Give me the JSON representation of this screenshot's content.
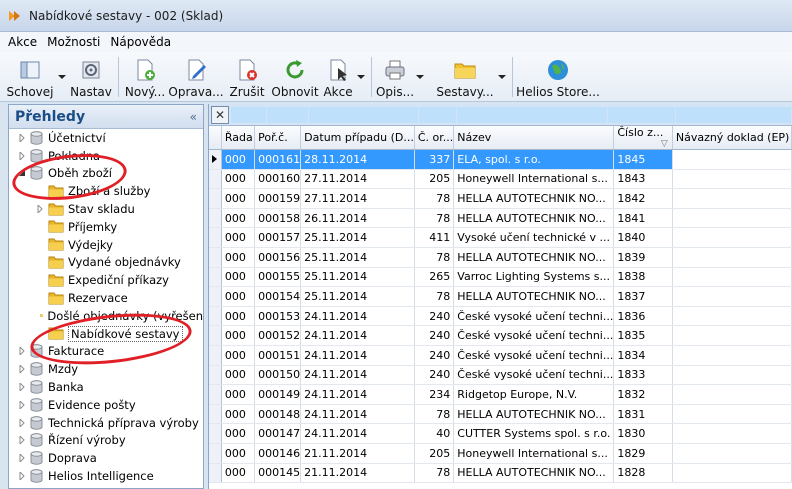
{
  "window": {
    "title": "Nabídkové sestavy - 002 (Sklad)"
  },
  "menu": [
    "Akce",
    "Možnosti",
    "Nápověda"
  ],
  "toolbar": [
    {
      "label": "Schovej",
      "icon": "schovej-icon",
      "dropdown": true
    },
    {
      "label": "Nastav",
      "icon": "gear-icon",
      "dropdown": false
    },
    {
      "label": "Nový...",
      "icon": "new-document-icon",
      "dropdown": false
    },
    {
      "label": "Oprava...",
      "icon": "edit-document-icon",
      "dropdown": false
    },
    {
      "label": "Zrušit",
      "icon": "delete-document-icon",
      "dropdown": false
    },
    {
      "label": "Obnovit",
      "icon": "refresh-icon",
      "dropdown": false
    },
    {
      "label": "Akce",
      "icon": "action-icon",
      "dropdown": true
    },
    {
      "label": "Opis...",
      "icon": "printer-icon",
      "dropdown": true
    },
    {
      "label": "Sestavy...",
      "icon": "folder-icon",
      "dropdown": true
    },
    {
      "label": "Helios Store...",
      "icon": "globe-icon",
      "dropdown": false
    }
  ],
  "sidebar": {
    "title": "Přehledy",
    "collapse_glyph": "«",
    "items": [
      {
        "label": "Účetnictví",
        "level": 0,
        "icon": "database-icon",
        "expanded": false
      },
      {
        "label": "Pokladna",
        "level": 0,
        "icon": "database-icon",
        "expanded": false
      },
      {
        "label": "Oběh zboží",
        "level": 0,
        "icon": "database-icon",
        "expanded": true
      },
      {
        "label": "Zboží a služby",
        "level": 1,
        "icon": "folder-icon",
        "expanded": null
      },
      {
        "label": "Stav skladu",
        "level": 1,
        "icon": "folder-icon",
        "expanded": false
      },
      {
        "label": "Příjemky",
        "level": 1,
        "icon": "folder-icon",
        "expanded": null
      },
      {
        "label": "Výdejky",
        "level": 1,
        "icon": "folder-icon",
        "expanded": null
      },
      {
        "label": "Vydané objednávky",
        "level": 1,
        "icon": "folder-icon",
        "expanded": null
      },
      {
        "label": "Expediční příkazy",
        "level": 1,
        "icon": "folder-icon",
        "expanded": null
      },
      {
        "label": "Rezervace",
        "level": 1,
        "icon": "folder-icon",
        "expanded": null
      },
      {
        "label": "Došlé objednávky (vyřešen",
        "level": 1,
        "icon": "folder-icon",
        "expanded": null
      },
      {
        "label": "Nabídkové sestavy",
        "level": 1,
        "icon": "folder-icon",
        "expanded": null,
        "selected": true
      },
      {
        "label": "Fakturace",
        "level": 0,
        "icon": "database-icon",
        "expanded": false
      },
      {
        "label": "Mzdy",
        "level": 0,
        "icon": "database-icon",
        "expanded": false
      },
      {
        "label": "Banka",
        "level": 0,
        "icon": "database-icon",
        "expanded": false
      },
      {
        "label": "Evidence pošty",
        "level": 0,
        "icon": "database-icon",
        "expanded": false
      },
      {
        "label": "Technická příprava výroby",
        "level": 0,
        "icon": "database-icon",
        "expanded": false
      },
      {
        "label": "Řízení výroby",
        "level": 0,
        "icon": "database-icon",
        "expanded": false
      },
      {
        "label": "Doprava",
        "level": 0,
        "icon": "database-icon",
        "expanded": false
      },
      {
        "label": "Helios Intelligence",
        "level": 0,
        "icon": "database-icon",
        "expanded": false
      }
    ]
  },
  "grid": {
    "columns": [
      "Řada",
      "Poř.č.",
      "Datum případu (D...",
      "Č. or...",
      "Název",
      "Číslo z...",
      "Návazný doklad (EP)"
    ],
    "sort_glyph": "▽",
    "selected_row": 0,
    "rows": [
      [
        "000",
        "000161",
        "28.11.2014",
        "337",
        "ELA, spol. s r.o.",
        "1845",
        ""
      ],
      [
        "000",
        "000160",
        "27.11.2014",
        "205",
        "Honeywell International s...",
        "1843",
        ""
      ],
      [
        "000",
        "000159",
        "27.11.2014",
        "78",
        "HELLA AUTOTECHNIK NO...",
        "1842",
        ""
      ],
      [
        "000",
        "000158",
        "26.11.2014",
        "78",
        "HELLA AUTOTECHNIK NO...",
        "1841",
        ""
      ],
      [
        "000",
        "000157",
        "25.11.2014",
        "411",
        "Vysoké učení technické v ...",
        "1840",
        ""
      ],
      [
        "000",
        "000156",
        "25.11.2014",
        "78",
        "HELLA AUTOTECHNIK NO...",
        "1839",
        ""
      ],
      [
        "000",
        "000155",
        "25.11.2014",
        "265",
        "Varroc Lighting Systems s...",
        "1838",
        ""
      ],
      [
        "000",
        "000154",
        "25.11.2014",
        "78",
        "HELLA AUTOTECHNIK NO...",
        "1837",
        ""
      ],
      [
        "000",
        "000153",
        "24.11.2014",
        "240",
        "České vysoké učení techni...",
        "1836",
        ""
      ],
      [
        "000",
        "000152",
        "24.11.2014",
        "240",
        "České vysoké učení techni...",
        "1835",
        ""
      ],
      [
        "000",
        "000151",
        "24.11.2014",
        "240",
        "České vysoké učení techni...",
        "1834",
        ""
      ],
      [
        "000",
        "000150",
        "24.11.2014",
        "240",
        "České vysoké učení techni...",
        "1833",
        ""
      ],
      [
        "000",
        "000149",
        "24.11.2014",
        "234",
        "Ridgetop Europe, N.V.",
        "1832",
        ""
      ],
      [
        "000",
        "000148",
        "24.11.2014",
        "78",
        "HELLA AUTOTECHNIK NO...",
        "1831",
        ""
      ],
      [
        "000",
        "000147",
        "24.11.2014",
        "40",
        "CUTTER Systems spol. s r.o.",
        "1830",
        ""
      ],
      [
        "000",
        "000146",
        "21.11.2014",
        "205",
        "Honeywell International s...",
        "1829",
        ""
      ],
      [
        "000",
        "000145",
        "21.11.2014",
        "78",
        "HELLA AUTOTECHNIK NO...",
        "1828",
        ""
      ]
    ]
  },
  "colors": {
    "selection": "#3399ff",
    "annotation": "#e01f26",
    "sidebar_title": "#1a4c86",
    "filter_cell": "#bfe0fa"
  }
}
